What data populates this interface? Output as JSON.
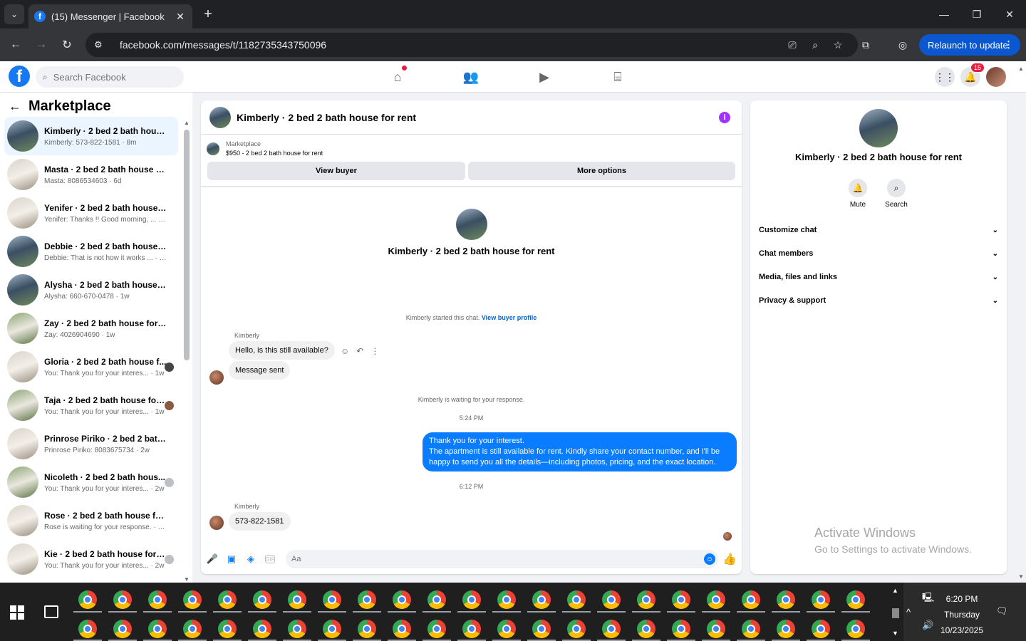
{
  "browser": {
    "tab_title": "(15) Messenger | Facebook",
    "url": "facebook.com/messages/t/1182735343750096",
    "relaunch_label": "Relaunch to update"
  },
  "fb": {
    "logo_letter": "f",
    "search_placeholder": "Search Facebook",
    "notification_count": "15"
  },
  "sidebar": {
    "title": "Marketplace",
    "conversations": [
      {
        "name": "Kimberly · 2 bed 2 bath house f...",
        "preview": "Kimberly: 573-822-1581 · 8m"
      },
      {
        "name": "Masta · 2 bed 2 bath house for ...",
        "preview": "Masta: 8086534603 · 6d"
      },
      {
        "name": "Yenifer · 2 bed 2 bath house for...",
        "preview": "Yenifer: Thanks !! Good morning, ... · 6d"
      },
      {
        "name": "Debbie · 2 bed 2 bath house for...",
        "preview": "Debbie: That is not how it works ... · 1w"
      },
      {
        "name": "Alysha · 2 bed 2 bath house for ...",
        "preview": "Alysha: 660-670-0478 · 1w"
      },
      {
        "name": "Zay · 2 bed 2 bath house for rent",
        "preview": "Zay: 4026904690 · 1w"
      },
      {
        "name": "Gloria · 2 bed 2 bath house f...",
        "preview": "You: Thank you for your interes... · 1w"
      },
      {
        "name": "Taja · 2 bed 2 bath house for ...",
        "preview": "You: Thank you for your interes... · 1w"
      },
      {
        "name": "Prinrose Piriko · 2 bed 2 bath h...",
        "preview": "Prinrose Piriko: 8083675734 · 2w"
      },
      {
        "name": "Nicoleth · 2 bed 2 bath hous...",
        "preview": "You: Thank you for your interes... · 2w"
      },
      {
        "name": "Rose · 2 bed 2 bath house for r...",
        "preview": "Rose is waiting for your response. · 2w"
      },
      {
        "name": "Kie · 2 bed 2 bath house for r...",
        "preview": "You: Thank you for your interes... · 2w"
      }
    ]
  },
  "chat": {
    "title": "Kimberly · 2 bed 2 bath house for rent",
    "marketplace_label": "Marketplace",
    "listing": "$950 - 2 bed 2 bath house for rent",
    "view_buyer": "View buyer",
    "more_options": "More options",
    "profile_name": "Kimberly · 2 bed 2 bath house for rent",
    "started_text": "Kimberly started this chat.",
    "view_buyer_profile": "View buyer profile",
    "sender": "Kimberly",
    "msg1": "Hello, is this still available?",
    "msg2": "Message sent",
    "waiting": "Kimberly is waiting for your response.",
    "time1": "5:24 PM",
    "out_line1": "Thank you for your interest.",
    "out_line2": "The apartment is still available for rent. Kindly share your contact number, and I'll be happy to send you all the details—including photos, pricing, and the exact location.",
    "time2": "6:12 PM",
    "msg3": "573-822-1581",
    "composer_placeholder": "Aa",
    "gif_label": "GIF"
  },
  "details": {
    "name": "Kimberly · 2 bed 2 bath house for rent",
    "mute": "Mute",
    "search": "Search",
    "sections": [
      "Customize chat",
      "Chat members",
      "Media, files and links",
      "Privacy & support"
    ]
  },
  "watermark": {
    "line1": "Activate Windows",
    "line2": "Go to Settings to activate Windows."
  },
  "taskbar": {
    "time": "6:20 PM",
    "day": "Thursday",
    "date": "10/23/2025"
  }
}
